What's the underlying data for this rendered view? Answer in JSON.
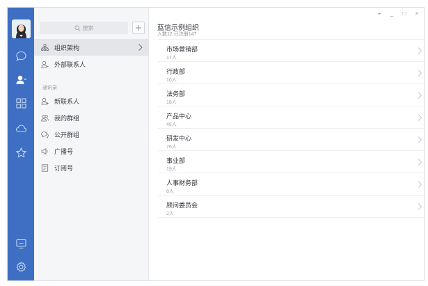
{
  "search": {
    "placeholder": "搜索"
  },
  "nav": {
    "org": "组织架构",
    "external": "外部联系人",
    "section": "通讯录",
    "new_contacts": "新联系人",
    "my_groups": "我的群组",
    "public_groups": "公开群组",
    "broadcast": "广播号",
    "subscription": "订阅号"
  },
  "main": {
    "title": "蓝信示例组织",
    "subtitle": "入数12 已注册147",
    "departments": [
      {
        "name": "市场营销部",
        "count": "17人"
      },
      {
        "name": "行政部",
        "count": "10人"
      },
      {
        "name": "法务部",
        "count": "18人"
      },
      {
        "name": "产品中心",
        "count": "45人"
      },
      {
        "name": "研发中心",
        "count": "76人"
      },
      {
        "name": "事业部",
        "count": "19人"
      },
      {
        "name": "人事财务部",
        "count": "8人"
      },
      {
        "name": "顾问委员会",
        "count": "2人"
      }
    ]
  },
  "window_controls": {
    "pin": "⌖",
    "minimize": "_",
    "maximize": "□",
    "close": "×"
  },
  "colors": {
    "rail": "#3e6fc3",
    "active_row": "#e3e5e9",
    "rail_icon": "#c7d7f1"
  },
  "icons": {
    "rail": [
      "chat-icon",
      "contacts-icon",
      "apps-icon",
      "cloud-icon",
      "star-icon",
      "screen-icon",
      "settings-icon"
    ]
  }
}
